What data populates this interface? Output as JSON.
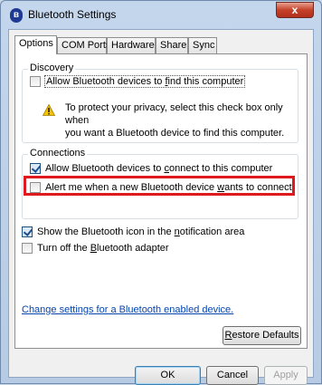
{
  "window": {
    "title": "Bluetooth Settings",
    "close_glyph": "x"
  },
  "tabs": [
    {
      "label": "Options"
    },
    {
      "label": "COM Ports"
    },
    {
      "label": "Hardware"
    },
    {
      "label": "Share"
    },
    {
      "label": "Sync"
    }
  ],
  "discovery": {
    "heading": "Discovery",
    "allow_find": {
      "pre": "Allow Bluetooth devices to ",
      "accel": "f",
      "post": "ind this computer",
      "checked": false
    },
    "warning_line1": "To protect your privacy, select this check box only when",
    "warning_line2": "you want a Bluetooth device to find this computer."
  },
  "connections": {
    "heading": "Connections",
    "allow_connect": {
      "pre": "Allow Bluetooth devices to ",
      "accel": "c",
      "post": "onnect to this computer",
      "checked": true
    },
    "alert_new": {
      "pre": "Alert me when a new Bluetooth device ",
      "accel": "w",
      "post": "ants to connect",
      "checked": false
    }
  },
  "show_icon": {
    "pre": "Show the Bluetooth icon in the ",
    "accel": "n",
    "post": "otification area",
    "checked": true
  },
  "turn_off": {
    "pre": "Turn off the ",
    "accel": "B",
    "post": "luetooth adapter",
    "checked": false
  },
  "link_text": "Change settings for a Bluetooth enabled device.",
  "restore": {
    "accel": "R",
    "post": "estore Defaults"
  },
  "buttons": {
    "ok": "OK",
    "cancel": "Cancel",
    "apply": "Apply"
  },
  "colors": {
    "highlight": "#e0191f",
    "link": "#0645ad",
    "warning": "#f5c400"
  }
}
